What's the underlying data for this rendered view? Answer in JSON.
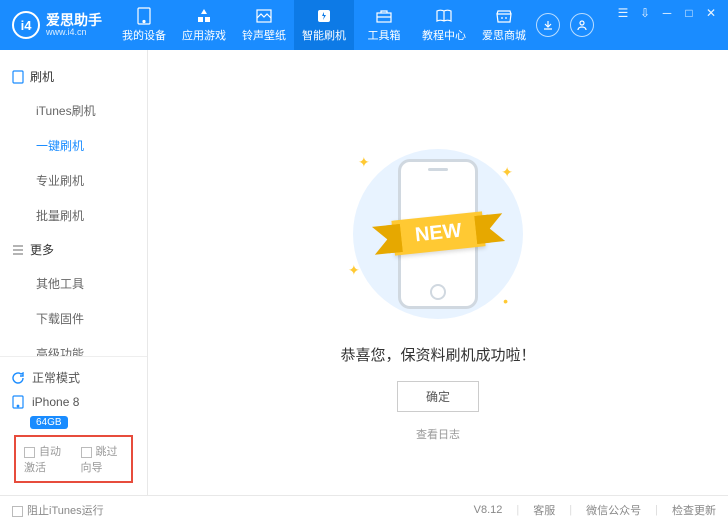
{
  "logo": {
    "text": "爱思助手",
    "url": "www.i4.cn"
  },
  "nav": [
    {
      "label": "我的设备"
    },
    {
      "label": "应用游戏"
    },
    {
      "label": "铃声壁纸"
    },
    {
      "label": "智能刷机",
      "active": true
    },
    {
      "label": "工具箱"
    },
    {
      "label": "教程中心"
    },
    {
      "label": "爱思商城"
    }
  ],
  "sidebar": {
    "g1": "刷机",
    "items1": [
      {
        "label": "iTunes刷机"
      },
      {
        "label": "一键刷机",
        "active": true
      },
      {
        "label": "专业刷机"
      },
      {
        "label": "批量刷机"
      }
    ],
    "g2": "更多",
    "items2": [
      {
        "label": "其他工具"
      },
      {
        "label": "下载固件"
      },
      {
        "label": "高级功能"
      }
    ],
    "mode": "正常模式",
    "device": "iPhone 8",
    "storage": "64GB",
    "auto_activate": "自动激活",
    "skip_guide": "跳过向导"
  },
  "main": {
    "ribbon": "NEW",
    "message": "恭喜您，保资料刷机成功啦！",
    "ok": "确定",
    "view_log": "查看日志"
  },
  "footer": {
    "block_itunes": "阻止iTunes运行",
    "version": "V8.12",
    "support": "客服",
    "wechat": "微信公众号",
    "check_update": "检查更新"
  }
}
